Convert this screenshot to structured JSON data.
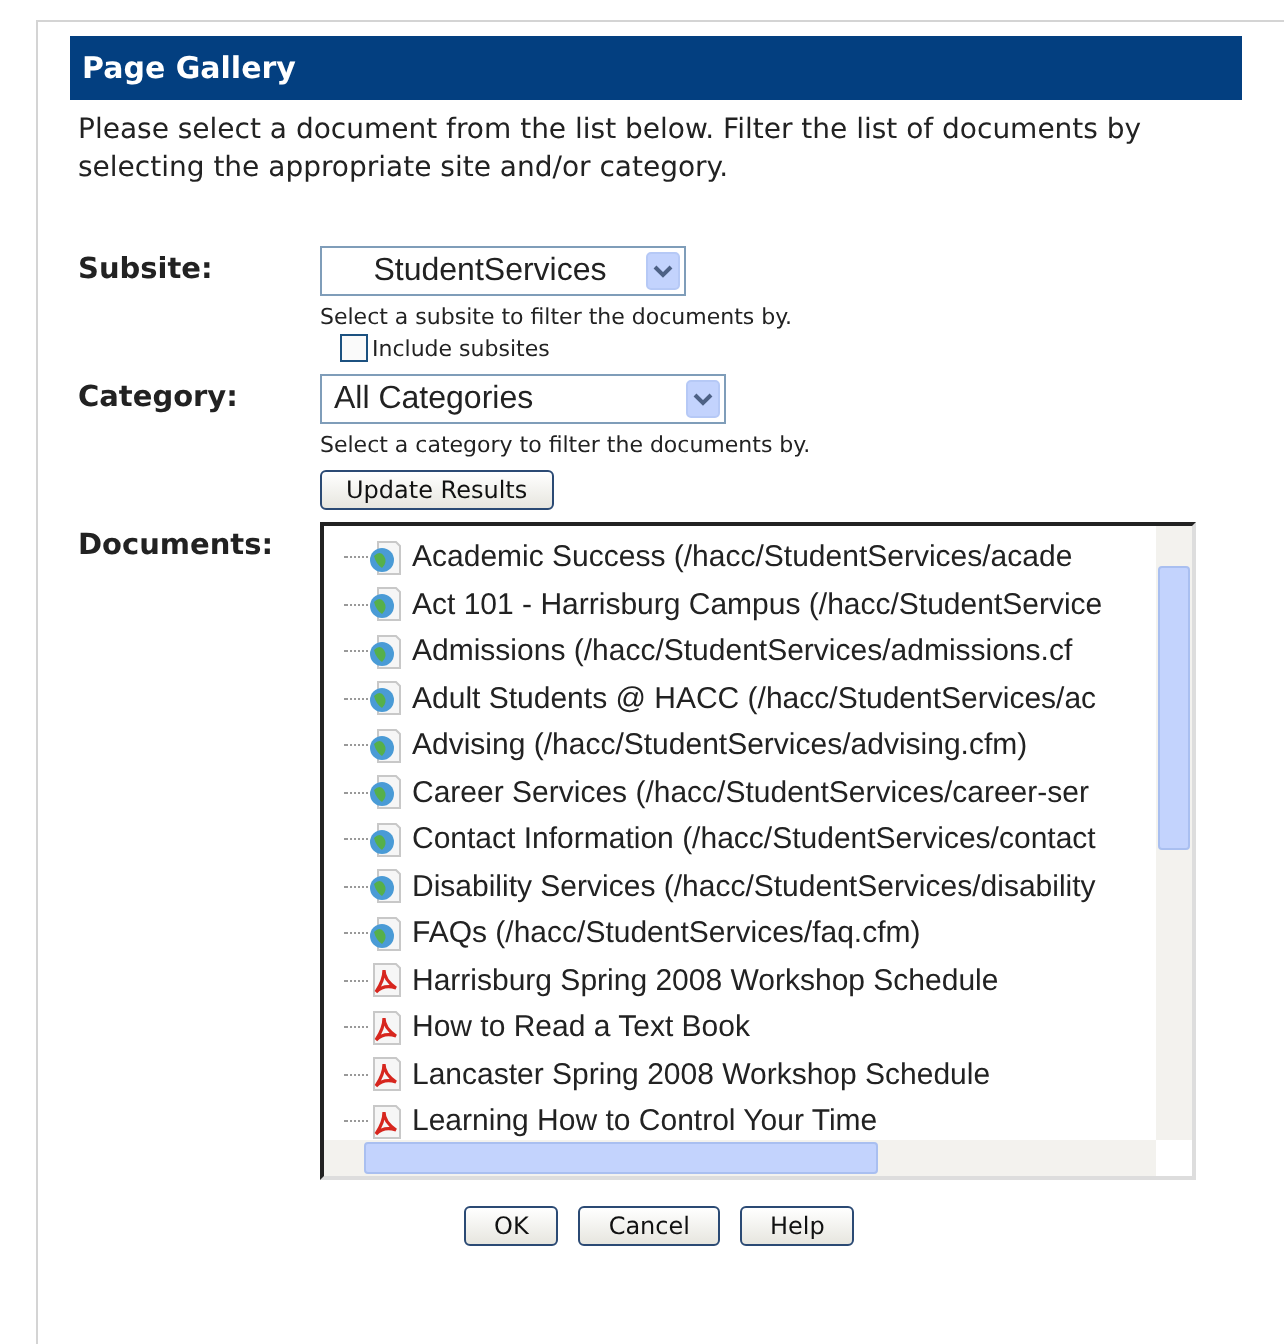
{
  "dialog": {
    "title": "Page Gallery",
    "intro": "Please select a document from the list below. Filter the list of documents by selecting the appropriate site and/or category.",
    "subsite": {
      "label": "Subsite:",
      "value": "StudentServices",
      "hint": "Select a subsite to filter the documents by.",
      "include_subsites": {
        "label": "Include subsites",
        "checked": false
      }
    },
    "category": {
      "label": "Category:",
      "value": "All Categories",
      "hint": "Select a category to filter the documents by."
    },
    "update_button": "Update Results",
    "documents": {
      "label": "Documents:",
      "items": [
        {
          "kind": "web",
          "text": "Academic Success (/hacc/StudentServices/acade"
        },
        {
          "kind": "web",
          "text": "Act 101 - Harrisburg Campus (/hacc/StudentService"
        },
        {
          "kind": "web",
          "text": "Admissions (/hacc/StudentServices/admissions.cf"
        },
        {
          "kind": "web",
          "text": "Adult Students @ HACC (/hacc/StudentServices/ac"
        },
        {
          "kind": "web",
          "text": "Advising (/hacc/StudentServices/advising.cfm)"
        },
        {
          "kind": "web",
          "text": "Career Services (/hacc/StudentServices/career-ser"
        },
        {
          "kind": "web",
          "text": "Contact Information (/hacc/StudentServices/contact"
        },
        {
          "kind": "web",
          "text": "Disability Services (/hacc/StudentServices/disability"
        },
        {
          "kind": "web",
          "text": "FAQs (/hacc/StudentServices/faq.cfm)"
        },
        {
          "kind": "pdf",
          "text": "Harrisburg Spring 2008 Workshop Schedule"
        },
        {
          "kind": "pdf",
          "text": "How to Read a Text Book"
        },
        {
          "kind": "pdf",
          "text": "Lancaster Spring 2008 Workshop Schedule"
        },
        {
          "kind": "pdf",
          "text": "Learning How to Control Your Time"
        }
      ]
    },
    "buttons": [
      "OK",
      "Cancel",
      "Help"
    ]
  }
}
